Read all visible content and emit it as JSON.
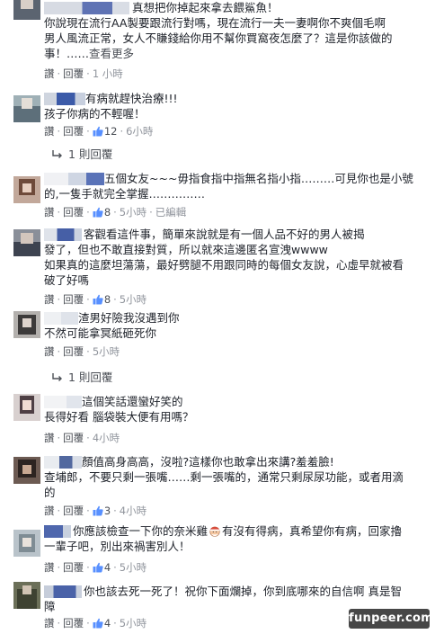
{
  "ui": {
    "like_label": "讚",
    "reply_label": "回覆",
    "reply_link_label": "1 則回覆",
    "more_label": "查看更多"
  },
  "comments": [
    {
      "lines": [
        "真想把你掉起來拿去餵鯊魚！",
        "你說現在流行AA製要跟流行對嗎，現在流行一夫一妻啊你不爽個毛啊",
        "男人風流正常，女人不賺錢給你用不幫你買窩夜怎麼了？這是你該做的",
        "事！……"
      ],
      "likes": "",
      "time": "1 小時",
      "edited": ""
    },
    {
      "lines": [
        "有病就趕快治療!!!",
        "孩子你病的不輕喔！"
      ],
      "likes": "12",
      "time": "6小時",
      "edited": ""
    },
    {
      "lines": [
        "五個女友~~~毋指食指中指無名指小指………可見你也是小號",
        "的,一隻手就完全掌握……………"
      ],
      "likes": "8",
      "time": "5小時",
      "edited": "已編輯"
    },
    {
      "lines": [
        "客觀看這件事，簡單來說就是有一個人品不好的男人被揭",
        "發了，但也不敢直接對質，所以就來這邊匿名宣洩wwww",
        "如果真的這麼坦蕩蕩，最好劈腿不用跟同時的每個女友說，心虛早就被看",
        "破了好嗎"
      ],
      "likes": "8",
      "time": "5小時",
      "edited": ""
    },
    {
      "lines": [
        "渣男好險我沒遇到你",
        "不然可能拿冥紙砸死你"
      ],
      "likes": "",
      "time": "5小時",
      "edited": ""
    },
    {
      "lines": [
        "這個笑話還蠻好笑的",
        "長得好看 腦袋裝大便有用嗎？"
      ],
      "likes": "",
      "time": "4小時",
      "edited": ""
    },
    {
      "lines": [
        "顏值高身高高，沒啦?這樣你也敢拿出來講?羞羞臉!",
        "查埔郎，不要只剩一張嘴……剩一張嘴的，通常只剩尿尿功能，或者用滴",
        "的"
      ],
      "likes": "3",
      "time": "4小時",
      "edited": ""
    },
    {
      "lines": [
        "你應該檢查一下你的奈米雞",
        "有沒有得病，真希望你有病，回家擼",
        "一輩子吧，別出來禍害別人！"
      ],
      "likes": "4",
      "time": "5小時",
      "edited": ""
    },
    {
      "lines": [
        "你也該去死一死了！祝你下面爛掉，你到底哪來的自信啊 真是智",
        "障"
      ],
      "likes": "4",
      "time": "5小時",
      "edited": ""
    }
  ],
  "watermark": "funpeer.com",
  "colors": {
    "link": "#365899",
    "meta": "#90949c",
    "text": "#1d2129",
    "like": "#5890ff",
    "emoji_face": "#f6c7a0",
    "emoji_hat": "#d84a3a"
  }
}
